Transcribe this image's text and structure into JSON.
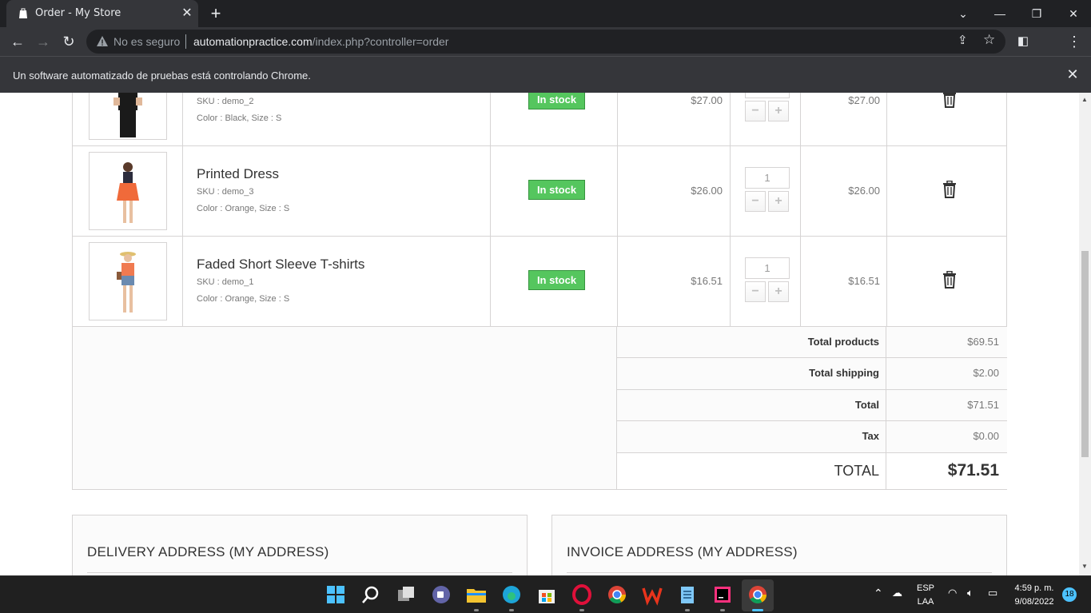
{
  "browser": {
    "tab_title": "Order - My Store",
    "tab_close": "✕",
    "new_tab": "+",
    "not_secure": "No es seguro",
    "url_host": "automationpractice.com",
    "url_path": "/index.php?controller=order",
    "infobar_text": "Un software automatizado de pruebas está controlando Chrome.",
    "infobar_close": "✕"
  },
  "cart": {
    "products": [
      {
        "name": "",
        "sku": "SKU : demo_2",
        "attributes": "Color : Black, Size : S",
        "availability": "In stock",
        "unit_price": "$27.00",
        "quantity": "",
        "total": "$27.00"
      },
      {
        "name": "Printed Dress",
        "sku": "SKU : demo_3",
        "attributes": "Color : Orange, Size : S",
        "availability": "In stock",
        "unit_price": "$26.00",
        "quantity": "1",
        "total": "$26.00"
      },
      {
        "name": "Faded Short Sleeve T-shirts",
        "sku": "SKU : demo_1",
        "attributes": "Color : Orange, Size : S",
        "availability": "In stock",
        "unit_price": "$16.51",
        "quantity": "1",
        "total": "$16.51"
      }
    ],
    "totals": {
      "total_products_label": "Total products",
      "total_products": "$69.51",
      "total_shipping_label": "Total shipping",
      "total_shipping": "$2.00",
      "total_label": "Total",
      "total": "$71.51",
      "tax_label": "Tax",
      "tax": "$0.00",
      "grand_total_label": "TOTAL",
      "grand_total": "$71.51"
    }
  },
  "addresses": {
    "delivery_title": "DELIVERY ADDRESS (MY ADDRESS)",
    "invoice_title": "INVOICE ADDRESS (MY ADDRESS)"
  },
  "taskbar": {
    "language": "ESP",
    "layout": "LAA",
    "time": "4:59 p. m.",
    "date": "9/08/2022",
    "notifications": "18"
  },
  "colors": {
    "in_stock": "#55c65e",
    "chrome_dark": "#202124",
    "chrome_toolbar": "#35363a"
  }
}
